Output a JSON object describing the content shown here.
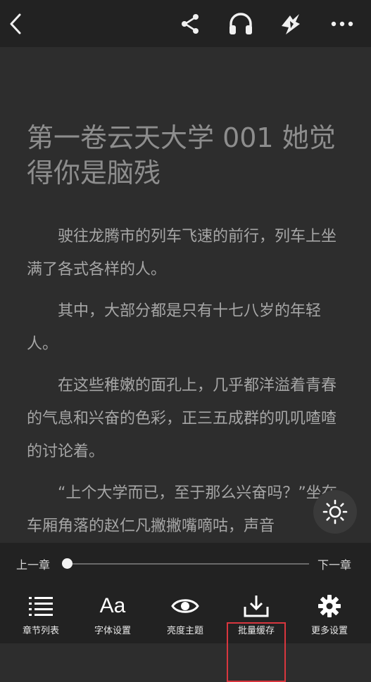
{
  "top_bar": {
    "icons": [
      "back-icon",
      "share-icon",
      "headphones-icon",
      "tip-icon",
      "more-icon"
    ]
  },
  "content": {
    "title": "第一卷云天大学 001 她觉得你是脑残",
    "paragraphs": [
      "驶往龙腾市的列车飞速的前行，列车上坐满了各式各样的人。",
      "其中，大部分都是只有十七八岁的年轻人。",
      "在这些稚嫩的面孔上，几乎都洋溢着青春的气息和兴奋的色彩，正三五成群的叽叽喳喳的讨论着。",
      "“上个大学而已，至于那么兴奋吗？”坐在车厢角落的赵仁凡撇撇嘴嘀咕，声音"
    ]
  },
  "chapter_nav": {
    "prev_label": "上一章",
    "next_label": "下一章",
    "progress": 0.0
  },
  "toolbar": {
    "items": [
      {
        "label": "章节列表",
        "icon": "list-icon"
      },
      {
        "label": "字体设置",
        "icon": "font-icon",
        "glyph": "Aa"
      },
      {
        "label": "亮度主题",
        "icon": "eye-icon"
      },
      {
        "label": "批量缓存",
        "icon": "download-icon",
        "highlighted": true
      },
      {
        "label": "更多设置",
        "icon": "gear-icon"
      }
    ]
  },
  "colors": {
    "background": "#2d2d2d",
    "bars": "#222222",
    "highlight": "#d9363e"
  }
}
